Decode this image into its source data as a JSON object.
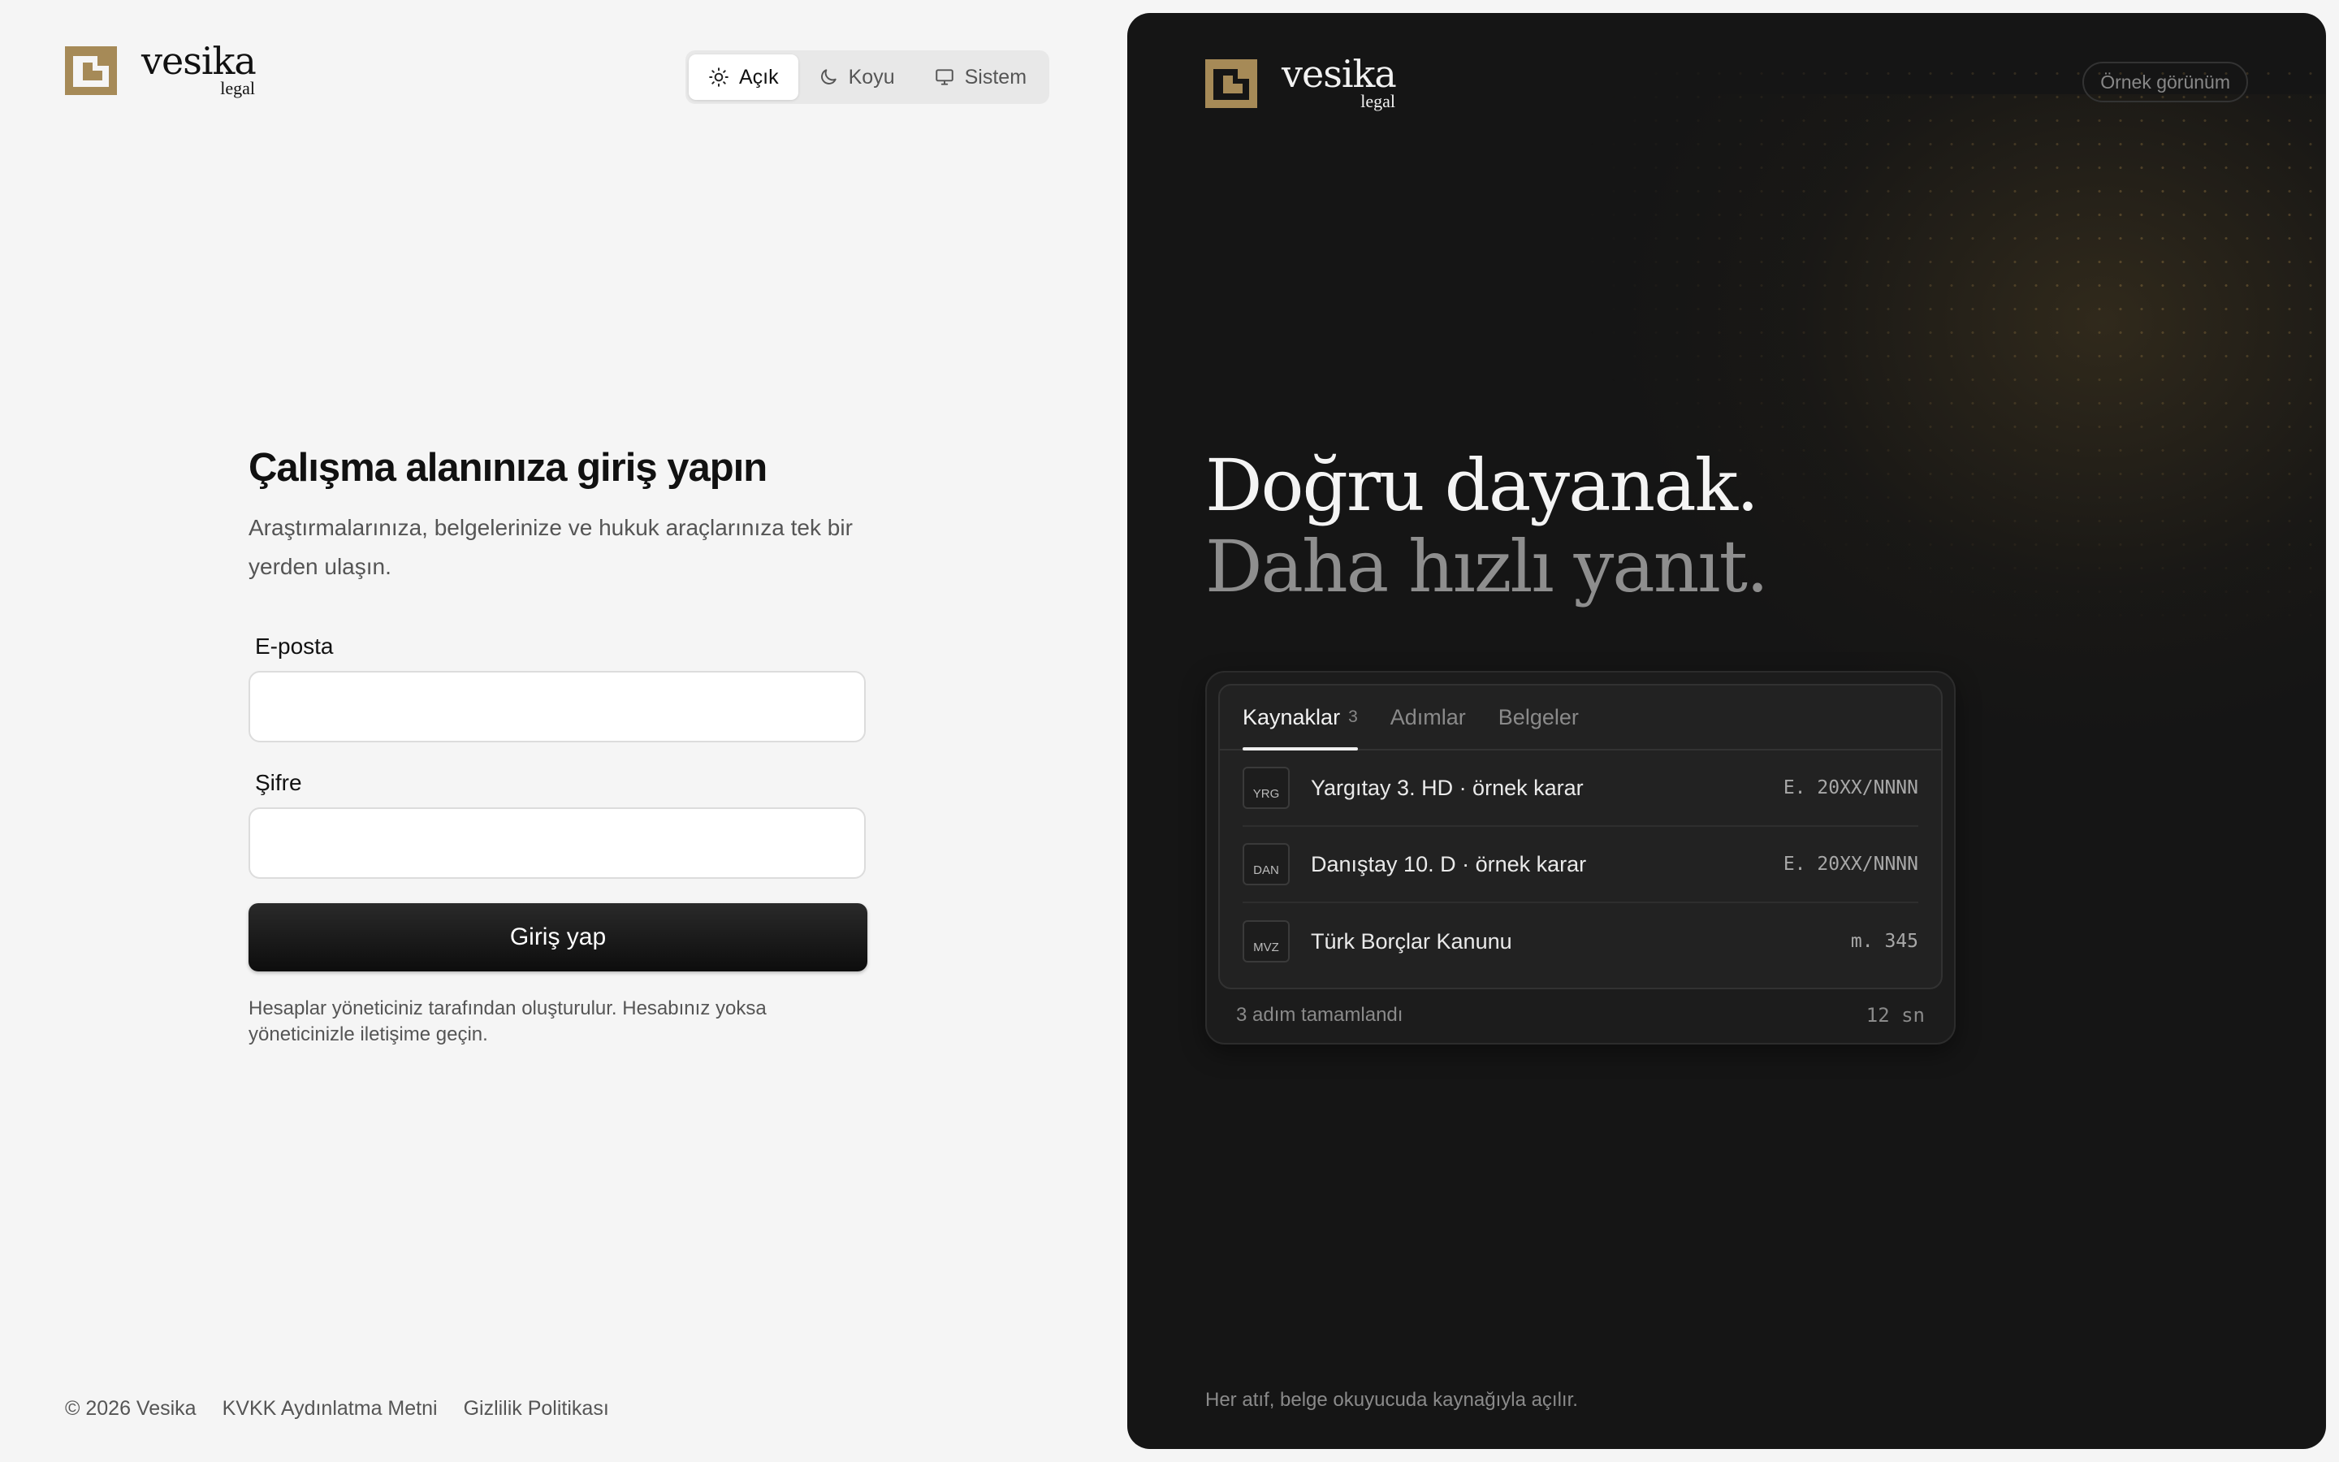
{
  "brand": {
    "word": "vesika",
    "sub": "legal",
    "accent_color": "#A68A57"
  },
  "theme_switch": {
    "options": [
      {
        "label": "Açık",
        "icon": "sun-icon",
        "active": true
      },
      {
        "label": "Koyu",
        "icon": "moon-icon",
        "active": false
      },
      {
        "label": "Sistem",
        "icon": "monitor-icon",
        "active": false
      }
    ]
  },
  "login": {
    "title": "Çalışma alanınıza giriş yapın",
    "subtitle": "Araştırmalarınıza, belgelerinize ve hukuk araçlarınıza tek bir yerden ulaşın.",
    "email_label": "E-posta",
    "email_value": "",
    "password_label": "Şifre",
    "password_value": "",
    "submit_label": "Giriş yap",
    "help_text": "Hesaplar yöneticiniz tarafından oluşturulur. Hesabınız yoksa yöneticinizle iletişime geçin."
  },
  "footer": {
    "copyright": "© 2026 Vesika",
    "links": [
      "KVKK Aydınlatma Metni",
      "Gizlilik Politikası"
    ]
  },
  "showcase": {
    "badge": "Örnek görünüm",
    "headline_1": "Doğru dayanak.",
    "headline_2": "Daha hızlı yanıt.",
    "tabs": [
      {
        "label": "Kaynaklar",
        "count": "3",
        "active": true
      },
      {
        "label": "Adımlar",
        "count": "",
        "active": false
      },
      {
        "label": "Belgeler",
        "count": "",
        "active": false
      }
    ],
    "sources": [
      {
        "chip": "YRG",
        "title": "Yargıtay 3. HD · örnek karar",
        "ref": "E. 20XX/NNNN"
      },
      {
        "chip": "DAN",
        "title": "Danıştay 10. D · örnek karar",
        "ref": "E. 20XX/NNNN"
      },
      {
        "chip": "MVZ",
        "title": "Türk Borçlar Kanunu",
        "ref": "m. 345"
      }
    ],
    "status_left": "3 adım tamamlandı",
    "status_right": "12 sn",
    "caption": "Her atıf, belge okuyucuda kaynağıyla açılır."
  }
}
